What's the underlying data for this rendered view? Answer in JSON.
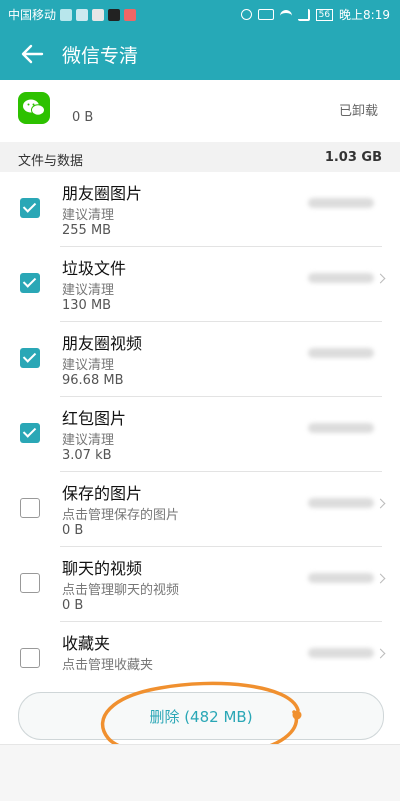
{
  "status": {
    "carrier": "中国移动",
    "battery": "56",
    "time": "晚上8:19"
  },
  "appbar": {
    "title": "微信专清"
  },
  "appinfo": {
    "size": "0 B",
    "state": "已卸载"
  },
  "section": {
    "title": "文件与数据",
    "total": "1.03 GB"
  },
  "items": [
    {
      "title": "朋友圈图片",
      "subtitle": "建议清理",
      "size": "255 MB",
      "checked": true
    },
    {
      "title": "垃圾文件",
      "subtitle": "建议清理",
      "size": "130 MB",
      "checked": true
    },
    {
      "title": "朋友圈视频",
      "subtitle": "建议清理",
      "size": "96.68 MB",
      "checked": true
    },
    {
      "title": "红包图片",
      "subtitle": "建议清理",
      "size": "3.07 kB",
      "checked": true
    },
    {
      "title": "保存的图片",
      "subtitle": "点击管理保存的图片",
      "size": "0 B",
      "checked": false
    },
    {
      "title": "聊天的视频",
      "subtitle": "点击管理聊天的视频",
      "size": "0 B",
      "checked": false
    },
    {
      "title": "收藏夹",
      "subtitle": "点击管理收藏夹",
      "size": "",
      "checked": false
    }
  ],
  "delete_label": "删除 (482 MB)",
  "colors": {
    "accent": "#26a9b7",
    "annotation": "#f0902f"
  }
}
